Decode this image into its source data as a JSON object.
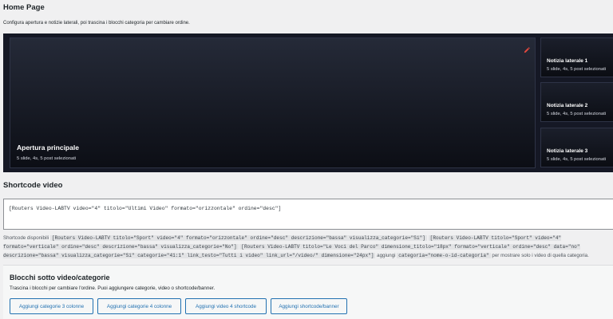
{
  "page": {
    "title": "Home Page",
    "description": "Configura apertura e notizie laterali, poi trascina i blocchi categoria per cambiare ordine."
  },
  "hero": {
    "main": {
      "title": "Apertura principale",
      "subtitle": "5 slide, 4s, 5 post selezionati",
      "edit_icon": "pencil-icon"
    },
    "side": [
      {
        "title": "Notizia laterale 1",
        "subtitle": "5 slide, 4s, 5 post selezionati"
      },
      {
        "title": "Notizia laterale 2",
        "subtitle": "5 slide, 4s, 5 post selezionati"
      },
      {
        "title": "Notizia laterale 3",
        "subtitle": "5 slide, 4s, 5 post selezionati"
      }
    ]
  },
  "shortcode": {
    "title": "Shortcode video",
    "value": "[Routers Video-LABTV video=\"4\" titolo=\"Ultimi Video\" formato=\"orizzontale\" ordine=\"desc\"]",
    "available_label": "Shortcode disponibili",
    "examples": [
      "[Routers Video-LABTV titolo=\"Sport\" video=\"4\" formato=\"orizzontale\" ordine=\"desc\" descrizione=\"bassa\" visualizza_categorie=\"Si\"]",
      "[Routers Video-LABTV titolo=\"Sport\" video=\"4\" formato=\"verticale\" ordine=\"desc\" descrizione=\"bassa\" visualizza_categorie=\"No\"]",
      "[Routers Video-LABTV titolo=\"Le Voci del Parco\" dimensione_titolo=\"18px\" formato=\"verticale\" ordine=\"desc\" data=\"no\" descrizione=\"bassa\" visualizza_categorie=\"Si\" categorie=\"41:1\" link_testo=\"Tutti i video\" link_url=\"/video/\" dimensione=\"24px\"]"
    ],
    "add_label": "aggiungi",
    "add_code": "categoria=\"nome-o-id-categoria\"",
    "add_suffix": "per mostrare solo i video di quella categoria."
  },
  "blocks": {
    "title": "Blocchi sotto video/categorie",
    "description": "Trascina i blocchi per cambiare l'ordine. Puoi aggiungere categorie, video o shortcode/banner.",
    "buttons": [
      "Aggiungi categorie 3 colonne",
      "Aggiungi categorie 4 colonne",
      "Aggiungi video 4 shortcode",
      "Aggiungi shortcode/banner"
    ]
  },
  "colors": {
    "accent": "#2271b1",
    "hero_bg": "#151825",
    "edit_icon": "#e0483e"
  }
}
